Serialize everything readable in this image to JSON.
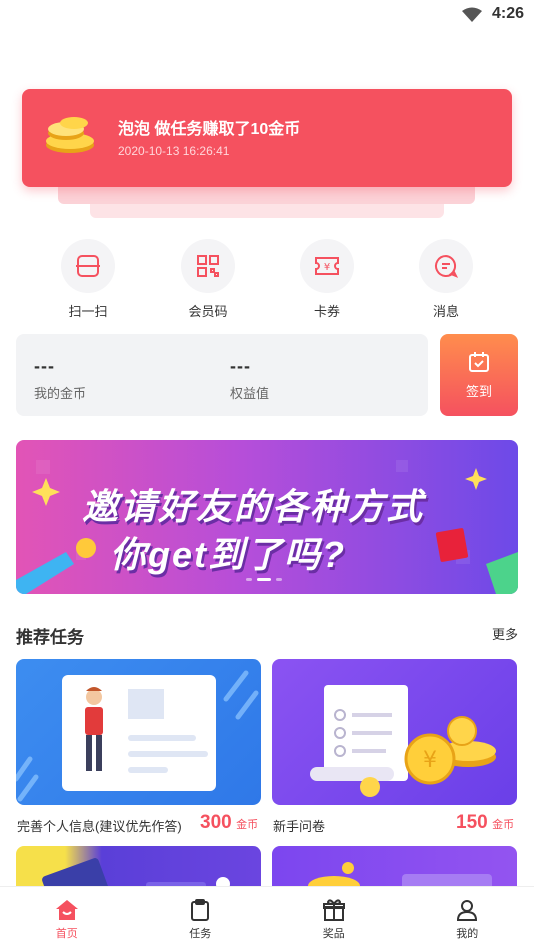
{
  "status_bar": {
    "time": "4:26"
  },
  "notification": {
    "title": "泡泡 做任务赚取了10金币",
    "timestamp": "2020-10-13 16:26:41"
  },
  "quick_actions": [
    {
      "label": "扫一扫",
      "icon": "scan-icon"
    },
    {
      "label": "会员码",
      "icon": "qr-code-icon"
    },
    {
      "label": "卡券",
      "icon": "coupon-icon"
    },
    {
      "label": "消息",
      "icon": "message-icon"
    }
  ],
  "stats": {
    "coins_value": "---",
    "coins_label": "我的金币",
    "rights_value": "---",
    "rights_label": "权益值",
    "signin_label": "签到"
  },
  "banner": {
    "line1": "邀请好友的各种方式",
    "line2": "你get到了吗?",
    "slide_count": 3,
    "active_slide": 2
  },
  "recommended": {
    "title": "推荐任务",
    "more": "更多",
    "tasks": [
      {
        "name": "完善个人信息(建议优先作答)",
        "coins": "300",
        "unit": "金币"
      },
      {
        "name": "新手问卷",
        "coins": "150",
        "unit": "金币"
      }
    ]
  },
  "nav": [
    {
      "label": "首页",
      "icon": "home-icon",
      "active": true
    },
    {
      "label": "任务",
      "icon": "clipboard-icon",
      "active": false
    },
    {
      "label": "奖品",
      "icon": "gift-icon",
      "active": false
    },
    {
      "label": "我的",
      "icon": "user-icon",
      "active": false
    }
  ],
  "colors": {
    "accent": "#f5515f",
    "signin_gradient_top": "#ff8d4d"
  }
}
